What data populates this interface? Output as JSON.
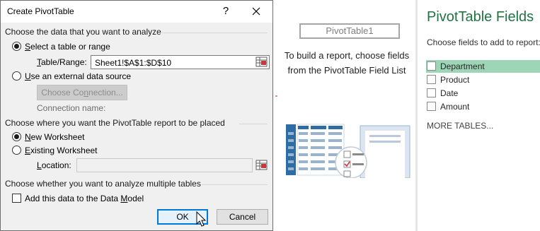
{
  "dialog": {
    "title": "Create PivotTable",
    "help_glyph": "?",
    "section1": "Choose the data that you want to analyze",
    "opt_table": {
      "accel": "S",
      "rest": "elect a table or range"
    },
    "range_label": {
      "accel": "T",
      "rest": "able/Range:"
    },
    "range_value": "Sheet1!$A$1:$D$10",
    "opt_external": {
      "accel": "U",
      "rest": "se an external data source"
    },
    "choose_connection": {
      "before": "Choose Co",
      "accel": "n",
      "after": "nection..."
    },
    "connection_name_label": "Connection name:",
    "section2": "Choose where you want the PivotTable report to be placed",
    "opt_new": {
      "accel": "N",
      "rest": "ew Worksheet"
    },
    "opt_existing": {
      "accel": "E",
      "rest": "xisting Worksheet"
    },
    "location_label": {
      "accel": "L",
      "rest": "ocation:"
    },
    "location_value": "",
    "section3": "Choose whether you want to analyze multiple tables",
    "add_model": {
      "before": "Add this data to the Data ",
      "accel": "M",
      "after": "odel"
    },
    "ok": "OK",
    "cancel": "Cancel"
  },
  "pivot": {
    "name": "PivotTable1",
    "description": "To build a report, choose fields from the PivotTable Field List"
  },
  "field_list": {
    "title": "PivotTable Fields",
    "subtitle": "Choose fields to add to report:",
    "fields": [
      "Department",
      "Product",
      "Date",
      "Amount"
    ],
    "more_tables": "MORE TABLES..."
  },
  "colors": {
    "accent_green": "#217346",
    "selected_field": "#9fd5b7",
    "arrow": "#e0357a",
    "focus_blue": "#0078d7"
  }
}
